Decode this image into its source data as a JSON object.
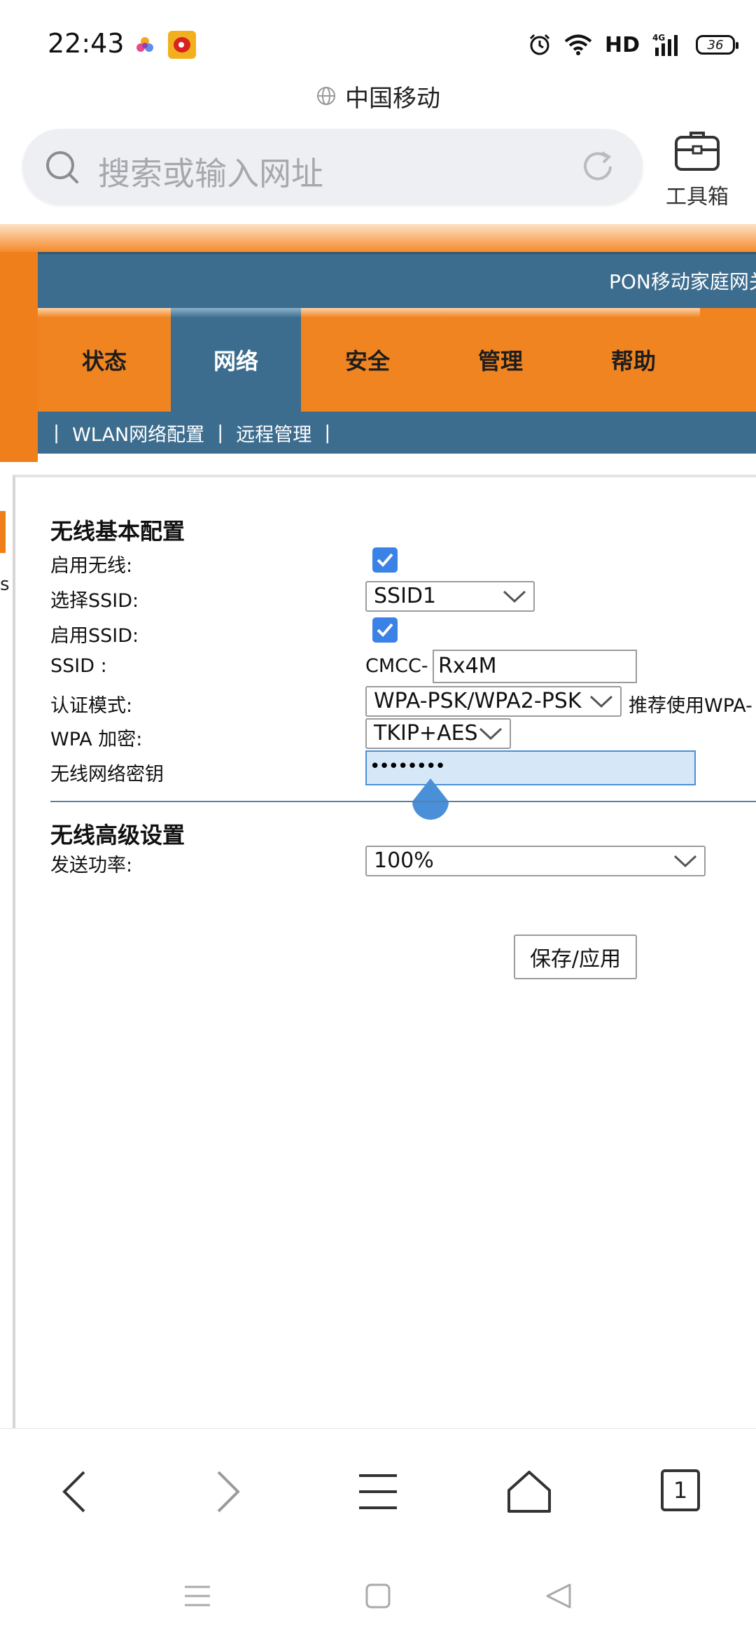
{
  "status_bar": {
    "time": "22:43",
    "hd": "HD",
    "network": "4G",
    "battery": "36"
  },
  "carrier": "中国移动",
  "browser": {
    "search_placeholder": "搜索或输入网址",
    "toolbox_label": "工具箱",
    "tab_count": "1"
  },
  "router": {
    "header_title": "PON移动家庭网关",
    "tabs": [
      {
        "label": "状态",
        "active": false
      },
      {
        "label": "网络",
        "active": true
      },
      {
        "label": "安全",
        "active": false
      },
      {
        "label": "管理",
        "active": false
      },
      {
        "label": "帮助",
        "active": false
      }
    ],
    "subnav": [
      "|",
      "WLAN网络配置",
      "|",
      "远程管理",
      "|"
    ],
    "side_letter": "s",
    "basic": {
      "title": "无线基本配置",
      "enable_wireless_label": "启用无线:",
      "enable_wireless_checked": true,
      "select_ssid_label": "选择SSID:",
      "select_ssid_value": "SSID1",
      "enable_ssid_label": "启用SSID:",
      "enable_ssid_checked": true,
      "ssid_label": "SSID :",
      "ssid_prefix": "CMCC-",
      "ssid_value": "Rx4M",
      "auth_label": "认证模式:",
      "auth_value": "WPA-PSK/WPA2-PSK",
      "auth_hint": "推荐使用WPA-",
      "encryption_label": "WPA 加密:",
      "encryption_value": "TKIP+AES",
      "key_label": "无线网络密钥",
      "key_value": "••••••••"
    },
    "advanced": {
      "title": "无线高级设置",
      "power_label": "发送功率:",
      "power_value": "100%"
    },
    "save_button": "保存/应用"
  },
  "colors": {
    "orange": "#ef8420",
    "blue": "#3d6d8e",
    "checkbox": "#3b82e6",
    "cursor_handle": "#4a90d9"
  }
}
